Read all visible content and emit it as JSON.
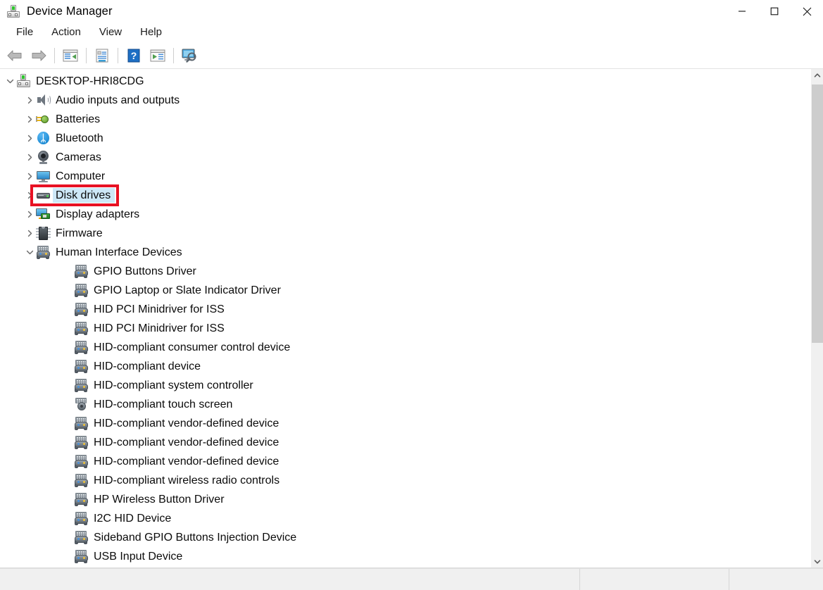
{
  "window": {
    "title": "Device Manager",
    "icon": "device-manager-icon",
    "controls": [
      {
        "name": "minimize-button",
        "glyph": "minimize"
      },
      {
        "name": "maximize-button",
        "glyph": "maximize"
      },
      {
        "name": "close-button",
        "glyph": "close"
      }
    ]
  },
  "menu": {
    "items": [
      {
        "label": "File"
      },
      {
        "label": "Action"
      },
      {
        "label": "View"
      },
      {
        "label": "Help"
      }
    ]
  },
  "toolbar": {
    "buttons": [
      {
        "name": "back-button",
        "icon": "back-arrow-icon",
        "label": "Back"
      },
      {
        "name": "forward-button",
        "icon": "forward-arrow-icon",
        "label": "Forward"
      },
      {
        "name": "show-hide-console-tree-button",
        "icon": "console-tree-icon",
        "label": "Show/Hide console tree"
      },
      {
        "name": "properties-button",
        "icon": "properties-icon",
        "label": "Properties"
      },
      {
        "name": "help-button",
        "icon": "help-question-icon",
        "label": "Help"
      },
      {
        "name": "update-driver-button",
        "icon": "update-driver-icon",
        "label": "Update driver"
      },
      {
        "name": "scan-hardware-changes-button",
        "icon": "scan-monitor-icon",
        "label": "Scan for hardware changes"
      }
    ]
  },
  "tree": {
    "root": {
      "label": "DESKTOP-HRI8CDG",
      "icon": "device-manager-icon",
      "expanded": true,
      "level": 0
    },
    "nodes": [
      {
        "label": "Audio inputs and outputs",
        "icon": "speaker-icon",
        "level": 1,
        "expandable": true,
        "expanded": false,
        "selected": false
      },
      {
        "label": "Batteries",
        "icon": "battery-icon",
        "level": 1,
        "expandable": true,
        "expanded": false,
        "selected": false
      },
      {
        "label": "Bluetooth",
        "icon": "bluetooth-icon",
        "level": 1,
        "expandable": true,
        "expanded": false,
        "selected": false
      },
      {
        "label": "Cameras",
        "icon": "camera-icon",
        "level": 1,
        "expandable": true,
        "expanded": false,
        "selected": false
      },
      {
        "label": "Computer",
        "icon": "monitor-icon",
        "level": 1,
        "expandable": true,
        "expanded": false,
        "selected": false
      },
      {
        "label": "Disk drives",
        "icon": "disk-drive-icon",
        "level": 1,
        "expandable": true,
        "expanded": false,
        "selected": true
      },
      {
        "label": "Display adapters",
        "icon": "display-adapter-icon",
        "level": 1,
        "expandable": true,
        "expanded": false,
        "selected": false
      },
      {
        "label": "Firmware",
        "icon": "firmware-chip-icon",
        "level": 1,
        "expandable": true,
        "expanded": false,
        "selected": false
      },
      {
        "label": "Human Interface Devices",
        "icon": "hid-icon",
        "level": 1,
        "expandable": true,
        "expanded": true,
        "selected": false
      },
      {
        "label": "GPIO Buttons Driver",
        "icon": "hid-icon",
        "level": 2,
        "expandable": false,
        "expanded": false,
        "selected": false
      },
      {
        "label": "GPIO Laptop or Slate Indicator Driver",
        "icon": "hid-icon",
        "level": 2,
        "expandable": false,
        "expanded": false,
        "selected": false
      },
      {
        "label": "HID PCI Minidriver for ISS",
        "icon": "hid-icon",
        "level": 2,
        "expandable": false,
        "expanded": false,
        "selected": false
      },
      {
        "label": "HID PCI Minidriver for ISS",
        "icon": "hid-icon",
        "level": 2,
        "expandable": false,
        "expanded": false,
        "selected": false
      },
      {
        "label": "HID-compliant consumer control device",
        "icon": "hid-icon",
        "level": 2,
        "expandable": false,
        "expanded": false,
        "selected": false
      },
      {
        "label": "HID-compliant device",
        "icon": "hid-icon",
        "level": 2,
        "expandable": false,
        "expanded": false,
        "selected": false
      },
      {
        "label": "HID-compliant system controller",
        "icon": "hid-icon",
        "level": 2,
        "expandable": false,
        "expanded": false,
        "selected": false
      },
      {
        "label": "HID-compliant touch screen",
        "icon": "hid-touch-screen-icon",
        "level": 2,
        "expandable": false,
        "expanded": false,
        "selected": false
      },
      {
        "label": "HID-compliant vendor-defined device",
        "icon": "hid-icon",
        "level": 2,
        "expandable": false,
        "expanded": false,
        "selected": false
      },
      {
        "label": "HID-compliant vendor-defined device",
        "icon": "hid-icon",
        "level": 2,
        "expandable": false,
        "expanded": false,
        "selected": false
      },
      {
        "label": "HID-compliant vendor-defined device",
        "icon": "hid-icon",
        "level": 2,
        "expandable": false,
        "expanded": false,
        "selected": false
      },
      {
        "label": "HID-compliant wireless radio controls",
        "icon": "hid-icon",
        "level": 2,
        "expandable": false,
        "expanded": false,
        "selected": false
      },
      {
        "label": "HP Wireless Button Driver",
        "icon": "hid-icon",
        "level": 2,
        "expandable": false,
        "expanded": false,
        "selected": false
      },
      {
        "label": "I2C HID Device",
        "icon": "hid-icon",
        "level": 2,
        "expandable": false,
        "expanded": false,
        "selected": false
      },
      {
        "label": "Sideband GPIO Buttons Injection Device",
        "icon": "hid-icon",
        "level": 2,
        "expandable": false,
        "expanded": false,
        "selected": false
      },
      {
        "label": "USB Input Device",
        "icon": "hid-icon",
        "level": 2,
        "expandable": false,
        "expanded": false,
        "selected": false
      }
    ]
  },
  "annotation": {
    "name": "disk-drives-highlight-rectangle",
    "color": "#e81123",
    "target": "Disk drives"
  },
  "scrollbar": {
    "name": "vertical-scrollbar",
    "up_arrow": "scroll-up-icon",
    "down_arrow": "scroll-down-icon"
  },
  "status_bar": {
    "segments": [
      "",
      "",
      ""
    ]
  },
  "colors": {
    "selection": "#cde8f7",
    "annotation": "#e81123",
    "window_bg": "#ffffff",
    "chrome_bg": "#f0f0f0"
  }
}
